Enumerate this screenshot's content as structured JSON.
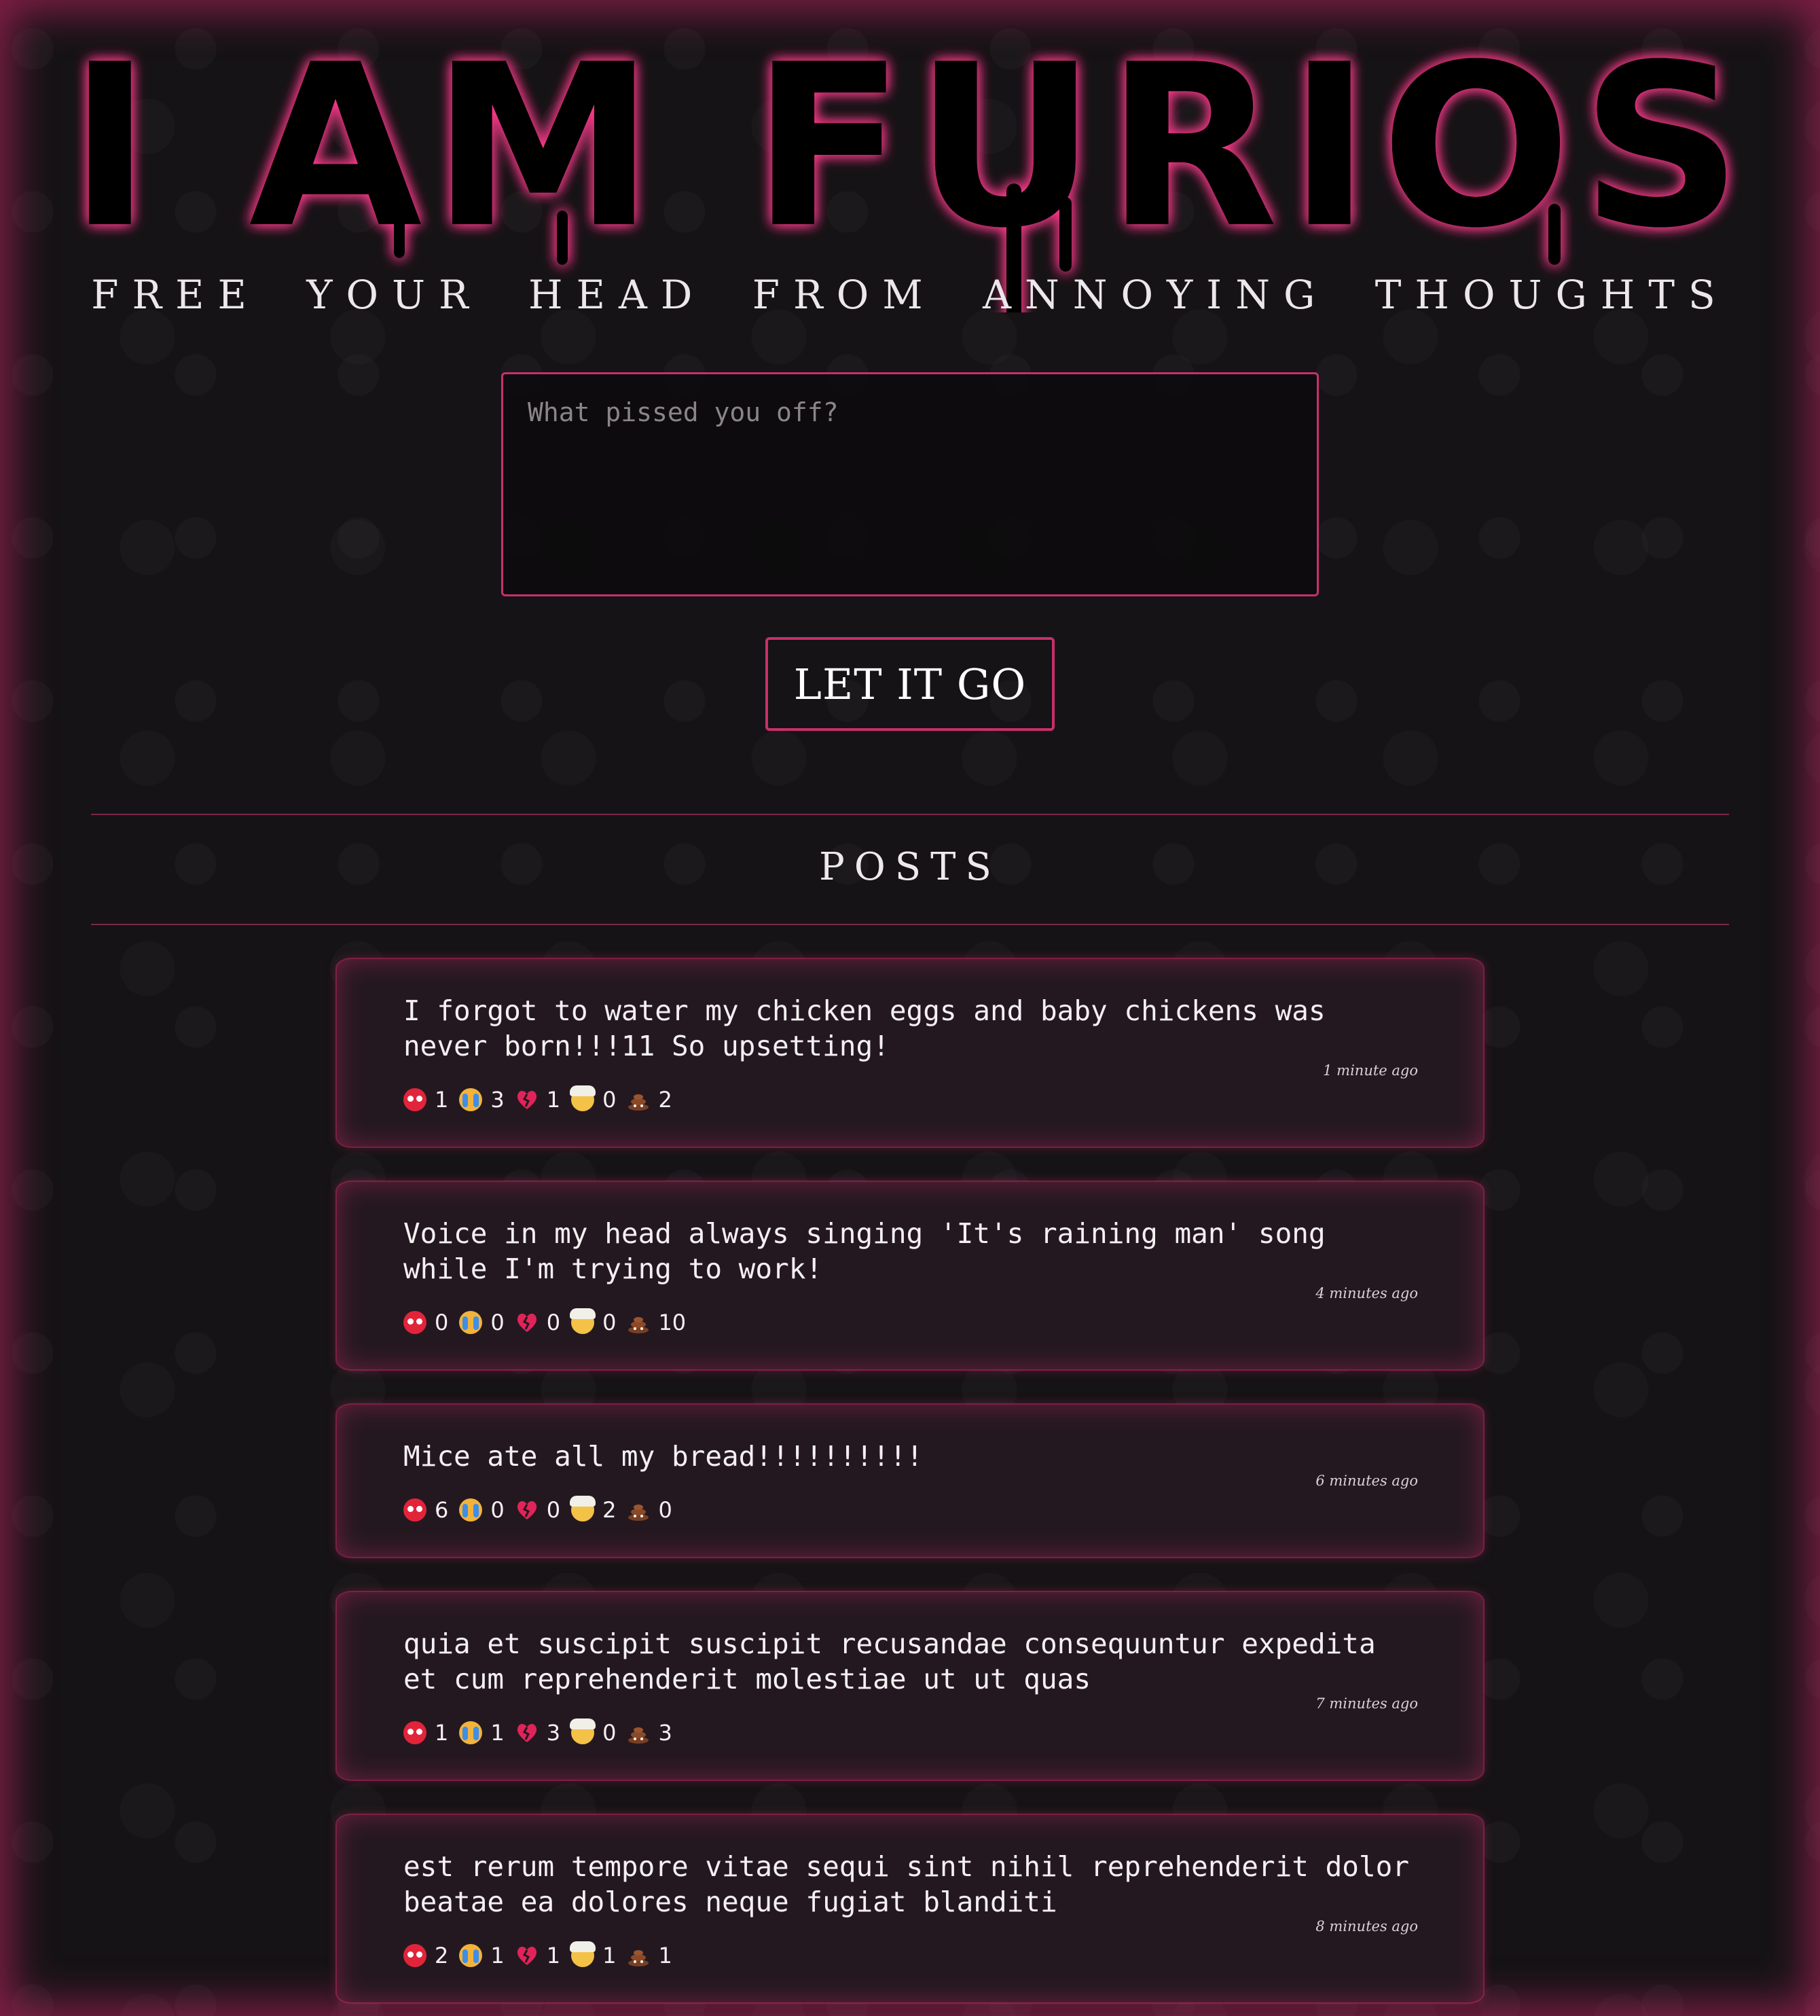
{
  "header": {
    "logo_text": "I AM FURIOS",
    "tagline": "FREE YOUR HEAD FROM ANNOYING THOUGHTS"
  },
  "composer": {
    "placeholder": "What pissed you off?",
    "value": "",
    "submit_label": "LET IT GO"
  },
  "posts_section": {
    "title": "POSTS"
  },
  "reaction_types": [
    "angry-face-icon",
    "crying-face-icon",
    "broken-heart-icon",
    "exploding-head-icon",
    "poop-icon"
  ],
  "colors": {
    "accent": "#c8306a",
    "background": "#151315",
    "card": "#241820"
  },
  "posts": [
    {
      "text": "I forgot to water my chicken eggs and baby chickens was never born!!!11 So upsetting!",
      "time": "1 minute ago",
      "reactions": [
        "1",
        "3",
        "1",
        "0",
        "2"
      ]
    },
    {
      "text": "Voice in my head always singing 'It's raining man' song while I'm trying to work!",
      "time": "4 minutes ago",
      "reactions": [
        "0",
        "0",
        "0",
        "0",
        "10"
      ]
    },
    {
      "text": "Mice ate all my bread!!!!!!!!!!",
      "time": "6 minutes ago",
      "reactions": [
        "6",
        "0",
        "0",
        "2",
        "0"
      ]
    },
    {
      "text": "quia et suscipit suscipit recusandae consequuntur expedita et cum reprehenderit molestiae ut ut quas",
      "time": "7 minutes ago",
      "reactions": [
        "1",
        "1",
        "3",
        "0",
        "3"
      ]
    },
    {
      "text": "est rerum tempore vitae sequi sint nihil reprehenderit dolor beatae ea dolores neque fugiat blanditi",
      "time": "8 minutes ago",
      "reactions": [
        "2",
        "1",
        "1",
        "1",
        "1"
      ]
    }
  ]
}
